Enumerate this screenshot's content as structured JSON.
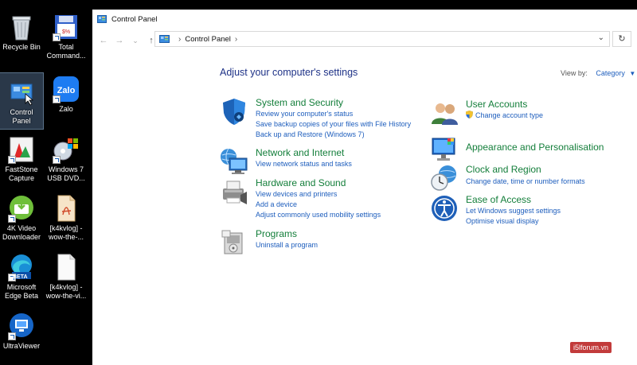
{
  "desktop": {
    "icons": [
      {
        "label": "Recycle Bin",
        "icon": "recycle-bin-icon"
      },
      {
        "label": "Total\nCommand...",
        "icon": "total-commander-icon"
      },
      {
        "label": "Control\nPanel",
        "icon": "control-panel-icon"
      },
      {
        "label": "Zalo",
        "icon": "zalo-icon",
        "text": "Zalo"
      },
      {
        "label": "FastStone\nCapture",
        "icon": "faststone-capture-icon"
      },
      {
        "label": "Windows 7\nUSB DVD...",
        "icon": "windows7-usb-dvd-icon"
      },
      {
        "label": "4K Video\nDownloader",
        "icon": "4k-video-downloader-icon"
      },
      {
        "label": "[k4kvlog] -\nwow-the-...",
        "icon": "pdf-file-icon"
      },
      {
        "label": "Microsoft\nEdge Beta",
        "icon": "edge-beta-icon",
        "badge": "BETA"
      },
      {
        "label": "[k4kvlog] -\nwow-the-vi...",
        "icon": "blank-file-icon"
      },
      {
        "label": "UltraViewer",
        "icon": "ultraviewer-icon"
      }
    ]
  },
  "window": {
    "title": "Control Panel",
    "address": {
      "path": "Control Panel"
    },
    "heading": "Adjust your computer's settings",
    "view_by": {
      "label": "View by:",
      "value": "Category"
    },
    "categories": [
      {
        "title": "System and Security",
        "icon": "shield-icon",
        "links": [
          "Review your computer's status",
          "Save backup copies of your files with File History",
          "Back up and Restore (Windows 7)"
        ]
      },
      {
        "title": "Network and Internet",
        "icon": "network-icon",
        "links": [
          "View network status and tasks"
        ]
      },
      {
        "title": "Hardware and Sound",
        "icon": "printer-icon",
        "links": [
          "View devices and printers",
          "Add a device",
          "Adjust commonly used mobility settings"
        ]
      },
      {
        "title": "Programs",
        "icon": "programs-icon",
        "links": [
          "Uninstall a program"
        ]
      },
      {
        "title": "User Accounts",
        "icon": "users-icon",
        "links": [
          "Change account type"
        ]
      },
      {
        "title": "Appearance and Personalisation",
        "icon": "monitor-icon",
        "links": []
      },
      {
        "title": "Clock and Region",
        "icon": "clock-icon",
        "links": [
          "Change date, time or number formats"
        ]
      },
      {
        "title": "Ease of Access",
        "icon": "ease-of-access-icon",
        "links": [
          "Let Windows suggest settings",
          "Optimise visual display"
        ]
      }
    ]
  },
  "watermark": "i5lforum.vn",
  "colors": {
    "category_title": "#137e3a",
    "link": "#1e5ebd",
    "heading": "#1e3287"
  }
}
